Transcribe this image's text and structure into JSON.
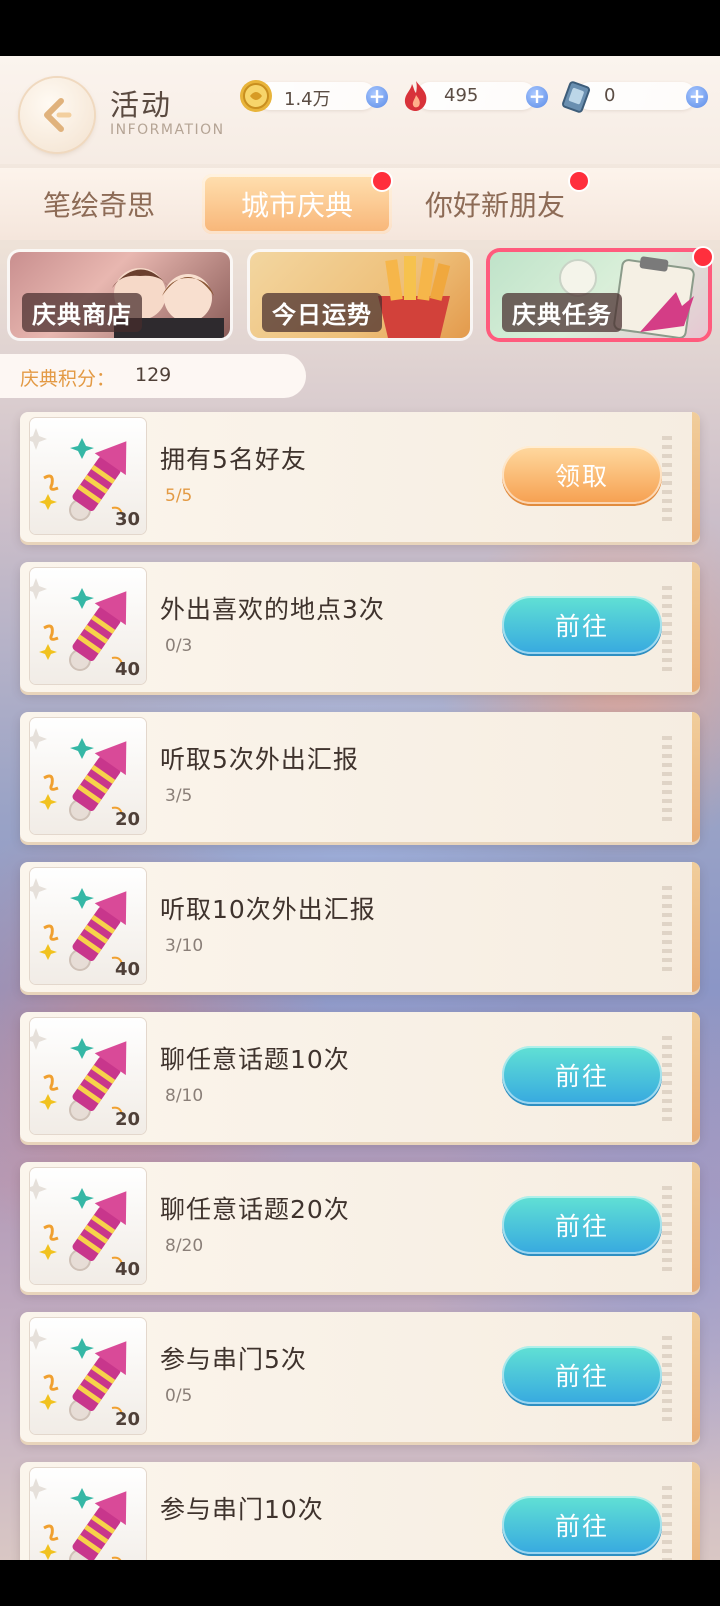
{
  "header": {
    "title": "活动",
    "subtitle": "INFORMATION",
    "currencies": [
      {
        "icon": "gold-coin-icon",
        "value": "1.4万"
      },
      {
        "icon": "red-flame-gem-icon",
        "value": "495"
      },
      {
        "icon": "ticket-card-icon",
        "value": "0"
      }
    ]
  },
  "tabs": [
    {
      "label": "笔绘奇思",
      "active": false,
      "badge": false
    },
    {
      "label": "城市庆典",
      "active": true,
      "badge": true
    },
    {
      "label": "你好新朋友",
      "active": false,
      "badge": true
    }
  ],
  "banners": [
    {
      "label": "庆典商店",
      "active": false
    },
    {
      "label": "今日运势",
      "active": false
    },
    {
      "label": "庆典任务",
      "active": true,
      "badge": true
    }
  ],
  "score": {
    "label": "庆典积分：",
    "value": "129"
  },
  "tasks": [
    {
      "name": "拥有5名好友",
      "progress": "5/5",
      "reward_qty": "30",
      "button": "领取",
      "button_type": "claim"
    },
    {
      "name": "外出喜欢的地点3次",
      "progress": "0/3",
      "reward_qty": "40",
      "button": "前往",
      "button_type": "go"
    },
    {
      "name": "听取5次外出汇报",
      "progress": "3/5",
      "reward_qty": "20",
      "button": "",
      "button_type": "none"
    },
    {
      "name": "听取10次外出汇报",
      "progress": "3/10",
      "reward_qty": "40",
      "button": "",
      "button_type": "none"
    },
    {
      "name": "聊任意话题10次",
      "progress": "8/10",
      "reward_qty": "20",
      "button": "前往",
      "button_type": "go"
    },
    {
      "name": "聊任意话题20次",
      "progress": "8/20",
      "reward_qty": "40",
      "button": "前往",
      "button_type": "go"
    },
    {
      "name": "参与串门5次",
      "progress": "0/5",
      "reward_qty": "20",
      "button": "前往",
      "button_type": "go"
    },
    {
      "name": "参与串门10次",
      "progress": "",
      "reward_qty": "",
      "button": "前往",
      "button_type": "go"
    }
  ],
  "colors": {
    "go_button": "#37a9e0",
    "claim_button": "#f6a050",
    "active_tab": "#f8b577",
    "badge": "#ff2f3d",
    "accent_text": "#e39a44"
  }
}
